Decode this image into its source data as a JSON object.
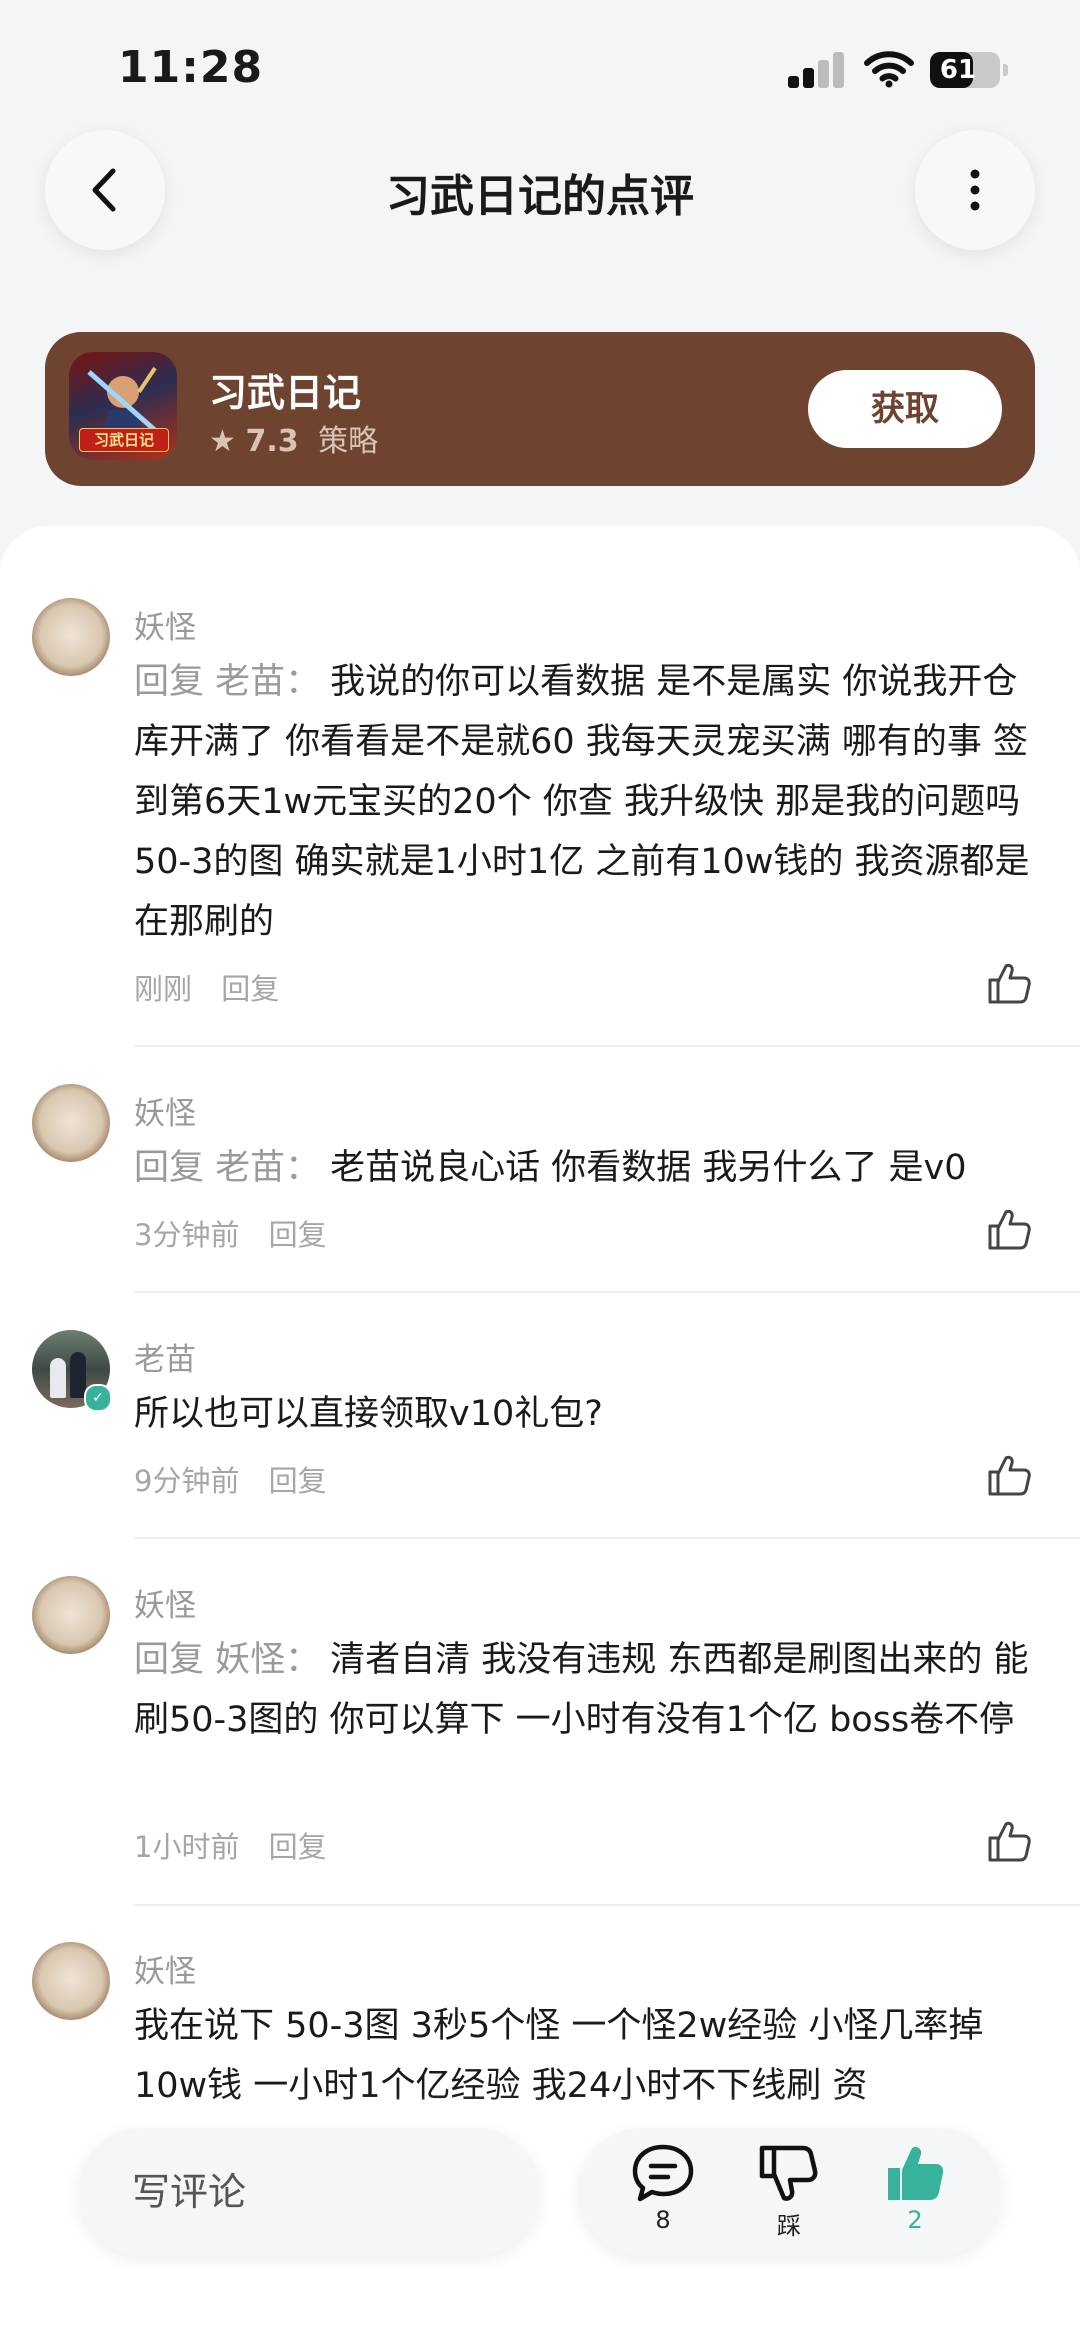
{
  "status_bar": {
    "time": "11:28",
    "battery": "61",
    "battery_level": 0.61
  },
  "header": {
    "title": "习武日记的点评"
  },
  "app": {
    "name": "习武日记",
    "rating": "7.3",
    "category": "策略",
    "get_label": "获取",
    "icon_caption": "习武日记"
  },
  "comments": [
    {
      "user": "妖怪",
      "reply_prefix": "回复 老苗：",
      "text": "我说的你可以看数据 是不是属实 你说我开仓库开满了 你看看是不是就60 我每天灵宠买满 哪有的事 签到第6天1w元宝买的20个 你查 我升级快 那是我的问题吗 50-3的图 确实就是1小时1亿 之前有10w钱的 我资源都是在那刷的",
      "time": "刚刚",
      "reply_label": "回复"
    },
    {
      "user": "妖怪",
      "reply_prefix": "回复 老苗：",
      "text": "老苗说良心话 你看数据 我另什么了 是v0",
      "time": "3分钟前",
      "reply_label": "回复"
    },
    {
      "user": "老苗",
      "reply_prefix": "",
      "text": "所以也可以直接领取v10礼包?",
      "time": "9分钟前",
      "reply_label": "回复"
    },
    {
      "user": "妖怪",
      "reply_prefix": "回复 妖怪：",
      "text": "清者自清 我没有违规 东西都是刷图出来的 能刷50-3图的 你可以算下 一小时有没有1个亿 boss卷不停",
      "time": "1小时前",
      "reply_label": "回复"
    },
    {
      "user": "妖怪",
      "reply_prefix": "",
      "text": "我在说下 50-3图 3秒5个怪 一个怪2w经验 小怪几率掉10w钱 一小时1个亿经验 我24小时不下线刷 资",
      "time": "",
      "reply_label": ""
    }
  ],
  "bottom_bar": {
    "write_placeholder": "写评论",
    "comment_count": "8",
    "dislike_label": "踩",
    "like_count": "2",
    "accent_color": "#36b39a"
  },
  "icons": [
    "back-icon",
    "more-icon",
    "star-icon",
    "like-icon",
    "comment-icon",
    "dislike-icon",
    "signal-icon",
    "wifi-icon",
    "battery-icon"
  ]
}
